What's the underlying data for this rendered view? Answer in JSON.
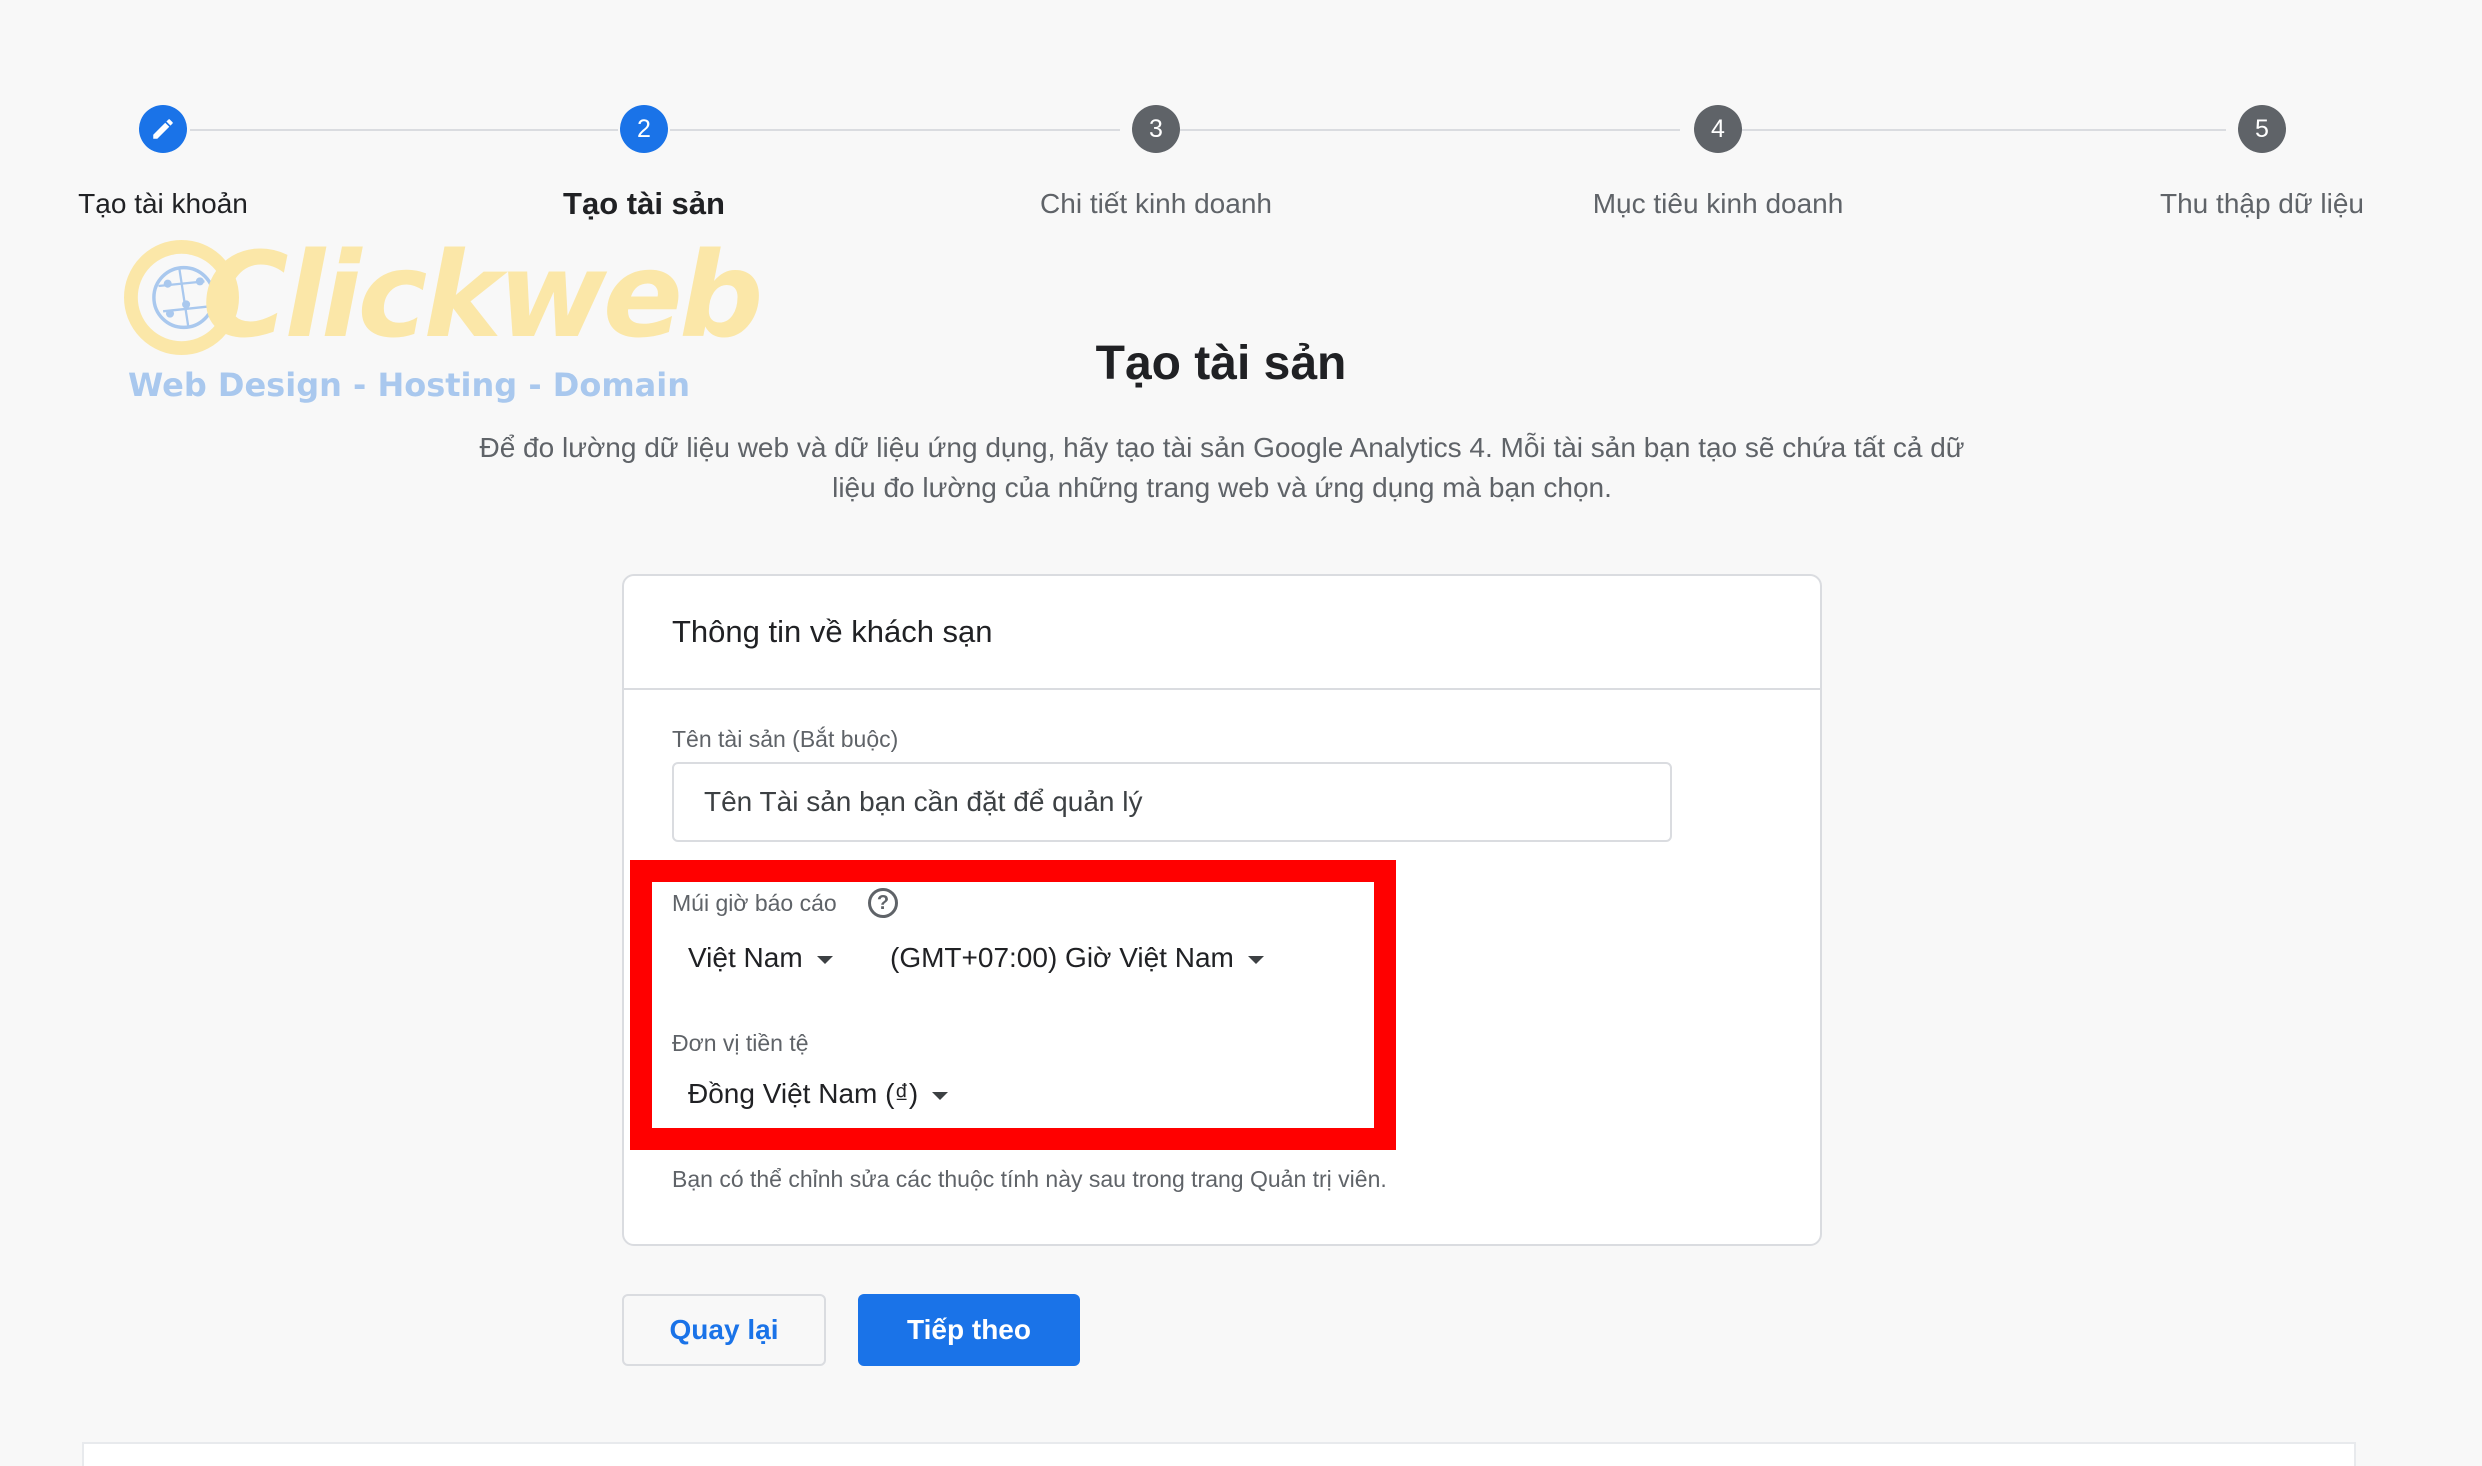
{
  "stepper": {
    "steps": [
      {
        "number": "",
        "label": "Tạo tài khoản",
        "state": "done"
      },
      {
        "number": "2",
        "label": "Tạo tài sản",
        "state": "current"
      },
      {
        "number": "3",
        "label": "Chi tiết kinh doanh",
        "state": "todo"
      },
      {
        "number": "4",
        "label": "Mục tiêu kinh doanh",
        "state": "todo"
      },
      {
        "number": "5",
        "label": "Thu thập dữ liệu",
        "state": "todo"
      }
    ]
  },
  "watermark": {
    "word": "Clickweb",
    "tagline": "Web Design - Hosting - Domain"
  },
  "page": {
    "title": "Tạo tài sản",
    "description_line1": "Để đo lường dữ liệu web và dữ liệu ứng dụng, hãy tạo tài sản Google Analytics 4. Mỗi tài sản bạn tạo sẽ chứa tất cả dữ",
    "description_line2": "liệu đo lường của những trang web và ứng dụng mà bạn chọn."
  },
  "card": {
    "header": "Thông tin về khách sạn",
    "property_name_label": "Tên tài sản (Bắt buộc)",
    "property_name_value": "Tên Tài sản bạn cần đặt để quản lý",
    "timezone_label": "Múi giờ báo cáo",
    "country_value": "Việt Nam",
    "timezone_value": "(GMT+07:00) Giờ Việt Nam",
    "currency_label": "Đơn vị tiền tệ",
    "currency_value": "Đồng Việt Nam (₫)",
    "note": "Bạn có thể chỉnh sửa các thuộc tính này sau trong trang Quản trị viên."
  },
  "buttons": {
    "back": "Quay lại",
    "next": "Tiếp theo"
  },
  "colors": {
    "primary": "#1a73e8",
    "step_inactive": "#5f6368",
    "highlight": "#ff0000",
    "watermark_yellow": "#fbe7a8",
    "watermark_blue": "#a9c8ee"
  }
}
